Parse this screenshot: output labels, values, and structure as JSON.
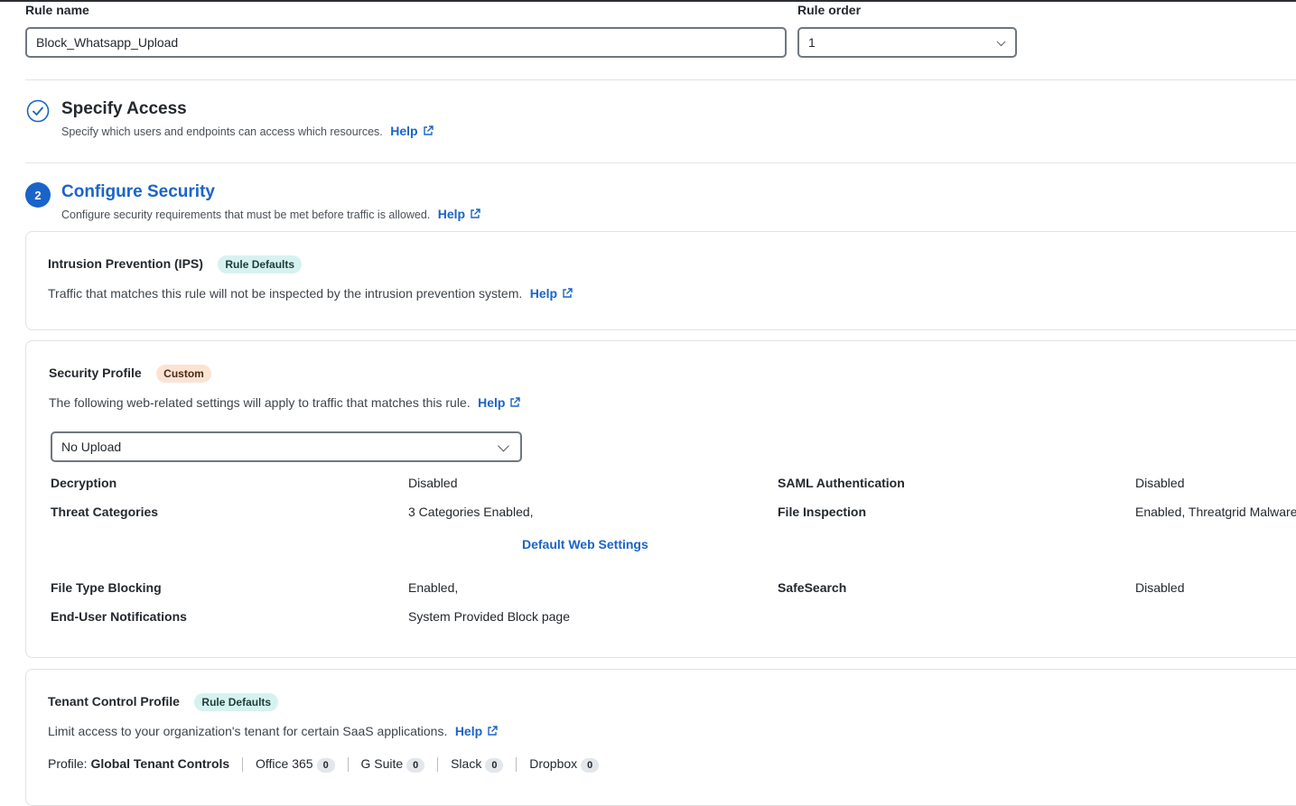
{
  "rule_name": {
    "label": "Rule name",
    "value": "Block_Whatsapp_Upload"
  },
  "rule_order": {
    "label": "Rule order",
    "value": "1"
  },
  "help_label": "Help",
  "step1": {
    "title": "Specify Access",
    "description": "Specify which users and endpoints can access which resources."
  },
  "step2": {
    "number": "2",
    "title": "Configure Security",
    "description": "Configure security requirements that must be met before traffic is allowed."
  },
  "ips": {
    "title": "Intrusion Prevention (IPS)",
    "badge": "Rule Defaults",
    "description": "Traffic that matches this rule will not be inspected by the intrusion prevention system."
  },
  "security_profile": {
    "title": "Security Profile",
    "badge": "Custom",
    "description": "The following web-related settings will apply to traffic that matches this rule.",
    "selected_profile": "No Upload",
    "rows": [
      {
        "label": "Decryption",
        "value": "Disabled",
        "label2": "SAML Authentication",
        "value2": "Disabled"
      },
      {
        "label": "Threat Categories",
        "value": "3 Categories Enabled,",
        "label2": "File Inspection",
        "value2": "Enabled, Threatgrid Malware"
      }
    ],
    "default_link": "Default Web Settings",
    "rows2": [
      {
        "label": "File Type Blocking",
        "value": "Enabled,",
        "label2": "SafeSearch",
        "value2": "Disabled"
      },
      {
        "label": "End-User Notifications",
        "value": "System Provided Block page"
      }
    ]
  },
  "tenant": {
    "title": "Tenant Control Profile",
    "badge": "Rule Defaults",
    "description": "Limit access to your organization's tenant for certain SaaS applications.",
    "profile_prefix": "Profile:",
    "profile_name": "Global Tenant Controls",
    "apps": [
      {
        "name": "Office 365",
        "count": "0"
      },
      {
        "name": "G Suite",
        "count": "0"
      },
      {
        "name": "Slack",
        "count": "0"
      },
      {
        "name": "Dropbox",
        "count": "0"
      }
    ]
  },
  "colors": {
    "accent": "#1a64c8",
    "step_badge": "#1a64c8",
    "rule_defaults_badge": "#d6f2f0",
    "custom_badge": "#fbe3d4"
  },
  "icons": [
    "check-circle-icon",
    "external-link-icon",
    "chevron-down-icon"
  ]
}
